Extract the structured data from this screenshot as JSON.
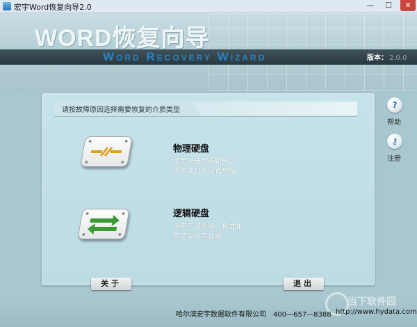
{
  "window": {
    "title": "宏宇Word恢复向导2.0",
    "controls": {
      "minimize": "—",
      "maximize": "☐",
      "close": "✕"
    }
  },
  "header": {
    "brand_title": "WORD恢复向导",
    "banner_text": "Word Recovery Wizard",
    "version_label": "版本：",
    "version_value": "2.0.0"
  },
  "panel": {
    "prompt": "请按故障原因选择需要恢复的介质类型",
    "options": [
      {
        "title": "物理硬盘",
        "desc_line1": "适用于硬盘逻辑分区",
        "desc_line2": "丢失或打开出错数据",
        "icon": "physical-disk-icon"
      },
      {
        "title": "逻辑硬盘",
        "desc_line1": "适用于误删除、格式化、",
        "desc_line2": "剪切失败等数据",
        "icon": "logical-disk-icon"
      }
    ]
  },
  "side": {
    "help_label": "帮助",
    "register_label": "注册",
    "help_icon": "help-icon",
    "register_icon": "key-icon"
  },
  "buttons": {
    "about": "关于",
    "exit": "退出"
  },
  "footer": {
    "company": "哈尔滨宏宇数据软件有限公司　400—657—8388",
    "url": "http://www.hydata.com",
    "watermark": "当下软件园"
  },
  "colors": {
    "accent": "#2c82c2",
    "banner": "#2a383f",
    "panel": "#c7e3ea"
  }
}
